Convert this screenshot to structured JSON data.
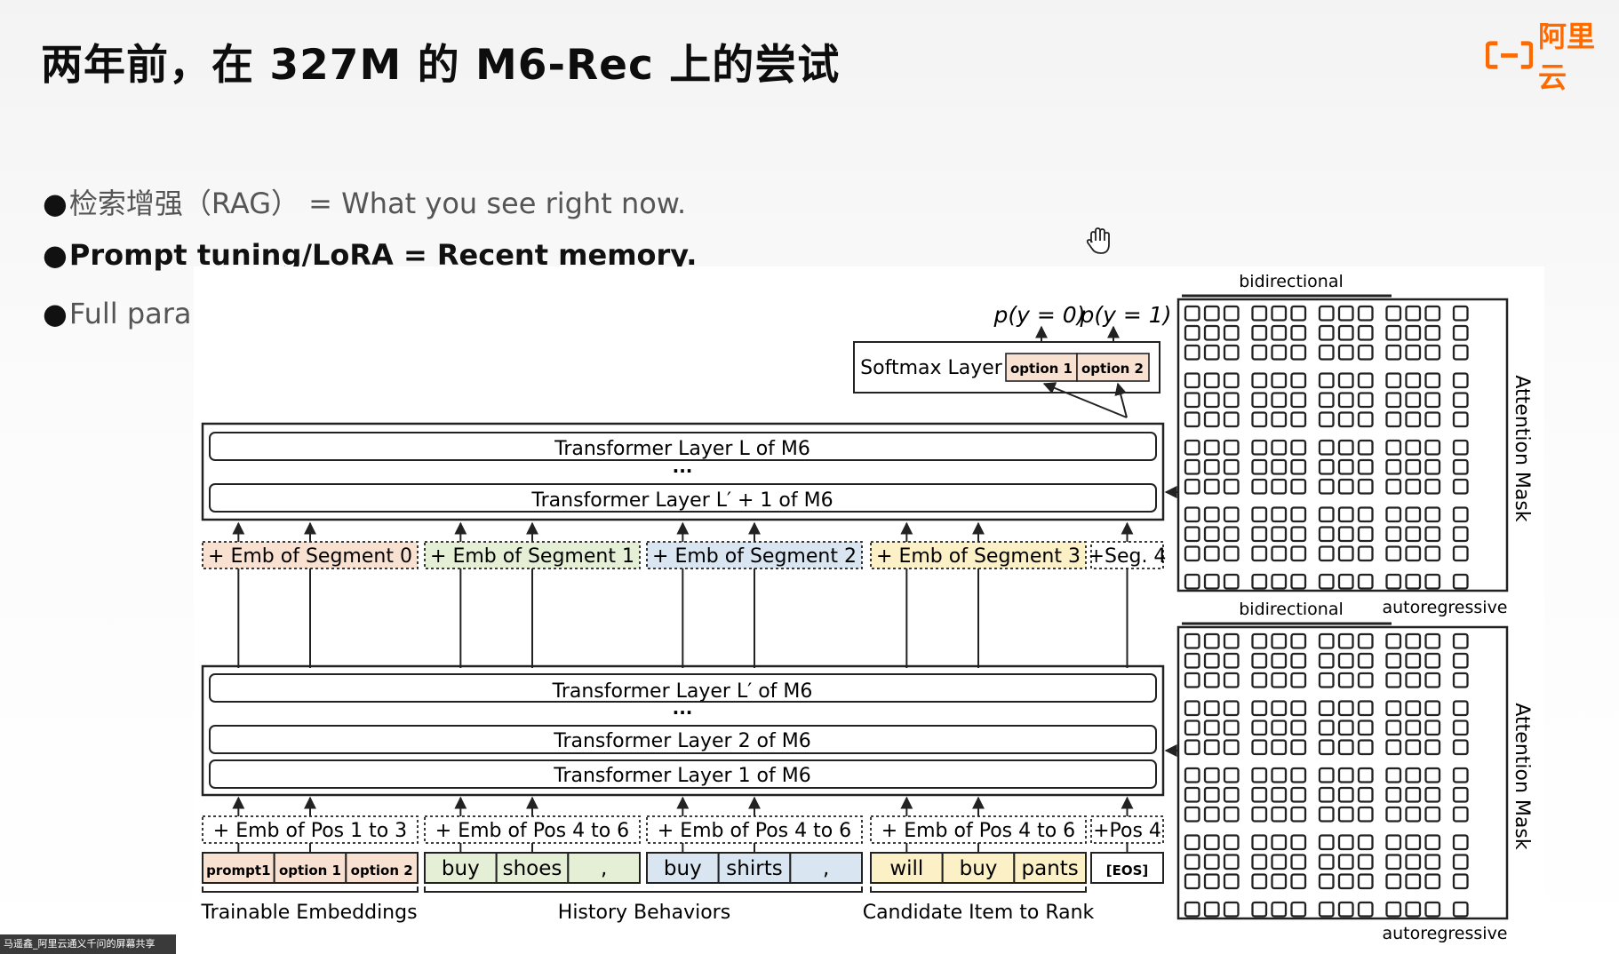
{
  "title": "两年前，在 327M 的 M6-Rec 上的尝试",
  "logo": {
    "text": "阿里云",
    "brand_color": "#ff6a00"
  },
  "bullets": [
    {
      "dot": "●",
      "text": "检索增强（RAG） = What you see right now."
    },
    {
      "dot": "●",
      "text": "Prompt tuning/LoRA = Recent memory."
    },
    {
      "dot": "●",
      "text": "Full parameter training = Long-term memory."
    }
  ],
  "diagram": {
    "softmax": {
      "label": "Softmax Layer",
      "opt1": "option 1",
      "opt2": "option 2",
      "py0": "p(y = 0)",
      "py1": "p(y = 1)"
    },
    "upper_layers": {
      "top": "Transformer Layer L of M6",
      "dots": "···",
      "bottom": "Transformer Layer L′ + 1 of M6"
    },
    "lower_layers": {
      "top": "Transformer Layer L′ of M6",
      "dots": "···",
      "mid": "Transformer Layer 2 of M6",
      "bottom": "Transformer Layer 1 of M6"
    },
    "segments": [
      "+ Emb of Segment 0",
      "+ Emb of Segment 1",
      "+ Emb of Segment 2",
      "+ Emb of Segment 3",
      "+Seg. 4"
    ],
    "positions": [
      "+ Emb of Pos 1 to 3",
      "+ Emb of Pos 4 to 6",
      "+ Emb of Pos 4 to 6",
      "+ Emb of Pos 4 to 6",
      "+Pos 4"
    ],
    "tokens": [
      {
        "text": "prompt1",
        "group": 0
      },
      {
        "text": "option 1",
        "group": 0
      },
      {
        "text": "option 2",
        "group": 0
      },
      {
        "text": "buy",
        "group": 1
      },
      {
        "text": "shoes",
        "group": 1
      },
      {
        "text": ",",
        "group": 1
      },
      {
        "text": "buy",
        "group": 2
      },
      {
        "text": "shirts",
        "group": 2
      },
      {
        "text": ",",
        "group": 2
      },
      {
        "text": "will",
        "group": 3
      },
      {
        "text": "buy",
        "group": 3
      },
      {
        "text": "pants",
        "group": 3
      },
      {
        "text": "[EOS]",
        "group": 4
      }
    ],
    "groups": [
      "Trainable Embeddings",
      "History Behaviors",
      "Candidate Item to Rank"
    ],
    "group_colors": [
      "#f9e1d2",
      "#e5efd6",
      "#d9e6f2",
      "#fbf0c6",
      "#ffffff"
    ],
    "mask_top": {
      "title": "bidirectional",
      "side": "Attention Mask",
      "bottom_left": "bidirectional",
      "bottom_right": "autoregressive"
    },
    "mask_bottom": {
      "side": "Attention Mask",
      "bottom_right": "autoregressive"
    }
  },
  "share_badge": "马遥鑫_阿里云通义千问的屏幕共享"
}
